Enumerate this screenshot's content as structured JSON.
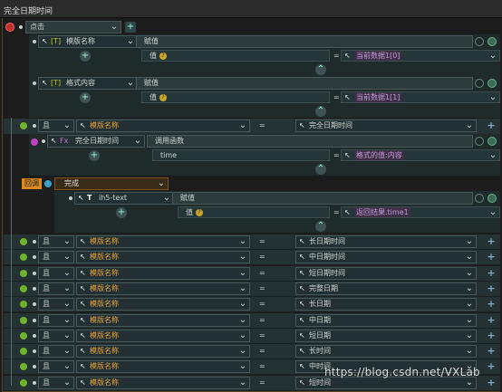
{
  "window": {
    "title": "完全日期时间"
  },
  "event": {
    "label": "点击"
  },
  "block1": {
    "field": "模版名称",
    "action": "赋值",
    "param": "值",
    "eq": "=",
    "value": "当前数据1[0]"
  },
  "block2": {
    "field": "格式内容",
    "action": "赋值",
    "param": "值",
    "eq": "=",
    "value": "当前数据1[1]"
  },
  "cond1": {
    "op": "且",
    "field": "模版名称",
    "eq": "=",
    "value": "完全日期时间"
  },
  "call": {
    "fn_label": "Fx",
    "name": "完全日期时间",
    "action": "调用函数",
    "param": "time",
    "eq": "=",
    "value": "格式的值:内容"
  },
  "callback": {
    "badge": "回调",
    "label": "完成",
    "target": "ih5-text",
    "action": "赋值",
    "param": "值",
    "eq": "=",
    "value": "返回结果.time1"
  },
  "conditions": [
    {
      "op": "且",
      "field": "模版名称",
      "eq": "=",
      "value": "长日期时间"
    },
    {
      "op": "且",
      "field": "模版名称",
      "eq": "=",
      "value": "中日期时间"
    },
    {
      "op": "且",
      "field": "模版名称",
      "eq": "=",
      "value": "短日期时间"
    },
    {
      "op": "且",
      "field": "模版名称",
      "eq": "=",
      "value": "完整日期"
    },
    {
      "op": "且",
      "field": "模版名称",
      "eq": "=",
      "value": "长日期"
    },
    {
      "op": "且",
      "field": "模版名称",
      "eq": "=",
      "value": "中日期"
    },
    {
      "op": "且",
      "field": "模版名称",
      "eq": "=",
      "value": "短日期"
    },
    {
      "op": "且",
      "field": "模版名称",
      "eq": "=",
      "value": "长时间"
    },
    {
      "op": "且",
      "field": "模版名称",
      "eq": "=",
      "value": "中时间"
    },
    {
      "op": "且",
      "field": "模版名称",
      "eq": "=",
      "value": "短时间"
    }
  ],
  "watermark": "https://blog.csdn.net/VXLab",
  "colors": {
    "accent_green": "#6fb230",
    "accent_magenta": "#c040c0",
    "tag_purple": "#c59ad8",
    "field_orange": "#e6a540",
    "badge_orange": "#d98a1f"
  }
}
